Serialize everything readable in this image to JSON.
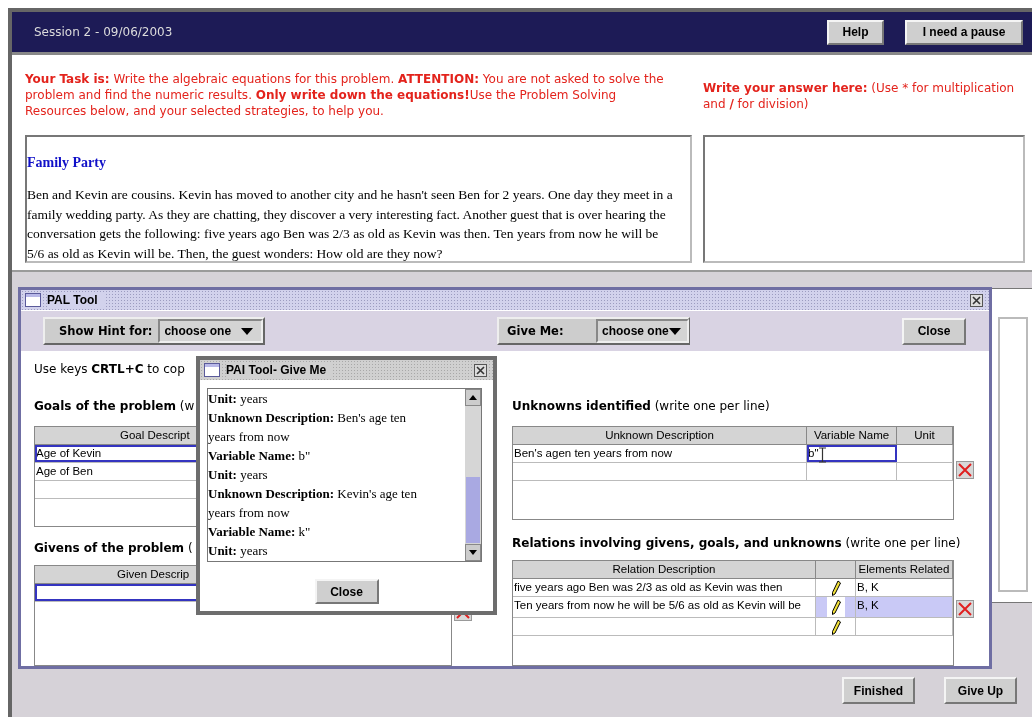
{
  "session_bar": {
    "title": "Session 2 - 09/06/2003",
    "buttons": [
      "Help",
      "I need a pause"
    ]
  },
  "task_instructions": "**Your Task is:** Write the algebraic equations for this problem. **ATTENTION:** You are not asked to solve the problem and find the numeric results. **Only write down the equations!**Use the Problem Solving Resources below, and your selected strategies, to help you.",
  "answer_prompt": "**Write your answer here:** (Use * for multiplication and **/** for division)",
  "problem": {
    "title": "Family Party",
    "text": "Ben and Kevin are cousins. Kevin has moved to another city and he hasn't seen Ben for 2 years. One day they meet in a family wedding party. As they are chatting, they discover a very interesting fact. Another guest that is over hearing the conversation gets the following: five years ago Ben was 2/3 as old as Kevin was then. Ten years from now he will be 5/6 as old as Kevin will be. Then, the guest wonders: How old are they now?"
  },
  "pal_tool": {
    "title": "PAL Tool",
    "hint_label": "Show Hint for:",
    "hint_value": "choose one",
    "give_me_label": "Give Me:",
    "give_me_value": "choose one",
    "close_button": "Close",
    "copy_hint": "Use keys **CRTL+C** to cop",
    "goals": {
      "heading": "**Goals of the problem** (w",
      "columns": [
        "Goal Descript"
      ],
      "rows": [
        {
          "text": "Age of Kevin",
          "selected": true
        },
        {
          "text": "Age of  Ben",
          "selected": false
        }
      ]
    },
    "givens": {
      "heading": "**Givens of the problem** (",
      "columns": [
        "Given Descrip"
      ],
      "rows": [
        {
          "editing": true
        }
      ]
    },
    "unknowns": {
      "heading": "**Unknowns identified** (write one per line)",
      "columns": [
        "Unknown Description",
        "Variable Name",
        "Unit"
      ],
      "rows": [
        {
          "description": "Ben's agen ten years from now",
          "variable_name": "b\"",
          "editing": true
        }
      ]
    },
    "relations": {
      "heading": "**Relations involving givens, goals, and unknowns** (write one per line)",
      "columns": [
        "Relation Description",
        "Elements Related"
      ],
      "rows": [
        {
          "description": "five years ago Ben was 2/3 as old as Kevin was then",
          "elements": "B, K",
          "selected": false
        },
        {
          "description": "Ten years from now he will be 5/6 as old as Kevin will be",
          "elements": "B, K",
          "selected": true
        },
        {
          "selected": false
        }
      ]
    }
  },
  "give_me_popup": {
    "title": "PAI Tool- Give Me",
    "lines": [
      "**Unit:** years",
      "**Unknown Description:** Ben's age ten",
      "years from now",
      "**Variable Name:** b\"",
      "**Unit:** years",
      "**Unknown Description:** Kevin's age ten",
      "years from now",
      "**Variable Name:** k\"",
      "**Unit:** years"
    ],
    "close_button": "Close"
  },
  "footer_buttons": [
    "Finished",
    "Give Up"
  ]
}
